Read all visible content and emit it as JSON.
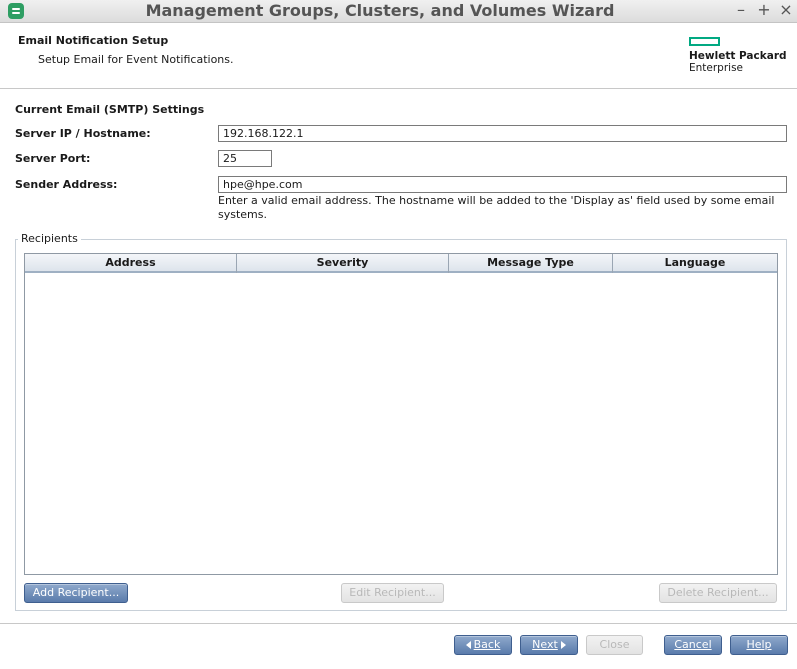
{
  "window": {
    "title": "Management Groups, Clusters, and Volumes Wizard",
    "minimize": "–",
    "maximize": "+",
    "close": "×"
  },
  "header": {
    "title": "Email Notification Setup",
    "subtitle": "Setup Email for Event Notifications.",
    "logo_line1": "Hewlett Packard",
    "logo_line2": "Enterprise",
    "logo_color": "#01a982"
  },
  "smtp": {
    "section_title": "Current Email (SMTP) Settings",
    "server_label": "Server IP / Hostname:",
    "server_value": "192.168.122.1",
    "port_label": "Server Port:",
    "port_value": "25",
    "sender_label": "Sender Address:",
    "sender_value": "hpe@hpe.com",
    "hint": "Enter a valid email address. The hostname will be added to the 'Display as' field used by some email systems."
  },
  "recipients": {
    "group_label": "Recipients",
    "columns": [
      "Address",
      "Severity",
      "Message Type",
      "Language"
    ],
    "rows": [],
    "add_button": "Add Recipient...",
    "edit_button": "Edit Recipient...",
    "delete_button": "Delete Recipient..."
  },
  "footer": {
    "back": "Back",
    "next": "Next",
    "close": "Close",
    "cancel": "Cancel",
    "help": "Help"
  }
}
